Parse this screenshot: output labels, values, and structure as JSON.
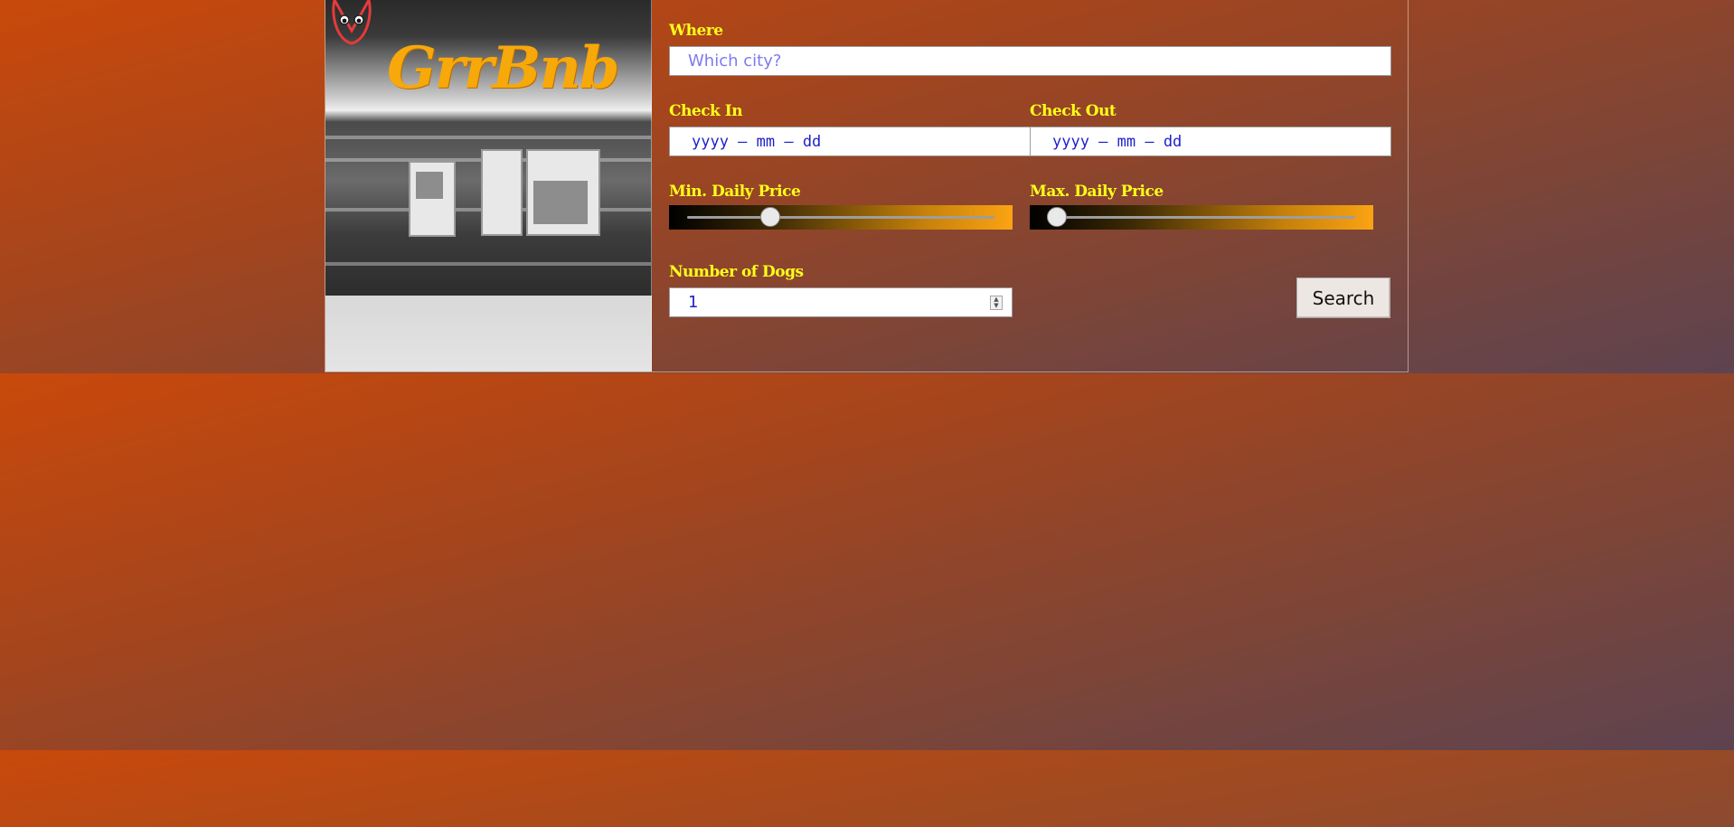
{
  "brand": {
    "name": "GrrBnb",
    "logo_icon": "dog-face-logo-icon"
  },
  "form": {
    "where": {
      "label": "Where",
      "placeholder": "Which city?"
    },
    "check_in": {
      "label": "Check In",
      "placeholder": "yyyy – mm – dd"
    },
    "check_out": {
      "label": "Check Out",
      "placeholder": "yyyy – mm – dd"
    },
    "min_price": {
      "label": "Min. Daily Price",
      "level": 0.27
    },
    "max_price": {
      "label": "Max. Daily Price",
      "level": 0.03
    },
    "dogs": {
      "label": "Number of Dogs",
      "value": "1"
    },
    "search_label": "Search"
  },
  "colors": {
    "label": "#ffff1a",
    "brand": "#f7a80a",
    "input_text": "#1e22c8",
    "background_start": "#c9490b",
    "background_end": "#5d4350"
  }
}
